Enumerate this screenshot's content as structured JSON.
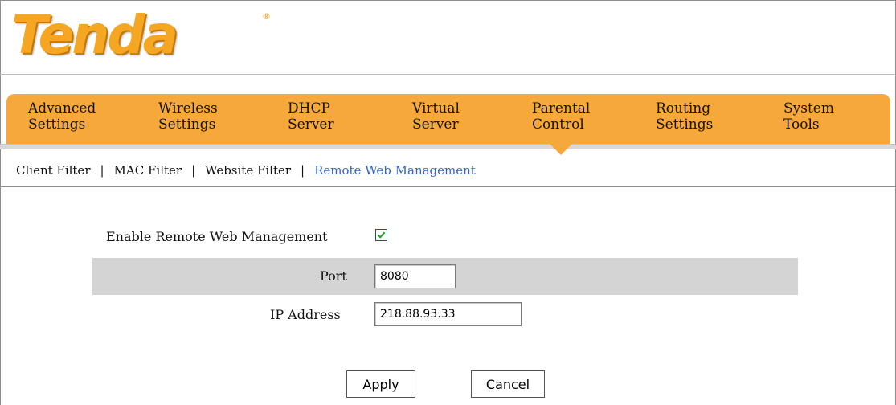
{
  "brand": {
    "logo_text": "Tenda",
    "registered_mark": "®"
  },
  "nav": {
    "items": [
      {
        "line1": "Advanced",
        "line2": "Settings"
      },
      {
        "line1": "Wireless",
        "line2": "Settings"
      },
      {
        "line1": "DHCP",
        "line2": "Server"
      },
      {
        "line1": "Virtual",
        "line2": "Server"
      },
      {
        "line1": "Parental",
        "line2": "Control"
      },
      {
        "line1": "Routing",
        "line2": "Settings"
      },
      {
        "line1": "System",
        "line2": "Tools"
      }
    ],
    "active": "Parental Control"
  },
  "subnav": {
    "items": [
      "Client Filter",
      "MAC Filter",
      "Website Filter",
      "Remote Web Management"
    ],
    "separator": "|",
    "active": "Remote Web Management"
  },
  "form": {
    "enable_label": "Enable Remote Web Management",
    "enable_checked": true,
    "port_label": "Port",
    "port_value": "8080",
    "ip_label": "IP Address",
    "ip_value": "218.88.93.33"
  },
  "buttons": {
    "apply": "Apply",
    "cancel": "Cancel"
  },
  "colors": {
    "accent": "#f6a93a",
    "logo": "#f5a623",
    "active_link": "#3366cc",
    "row_highlight": "#d4d4d4"
  }
}
